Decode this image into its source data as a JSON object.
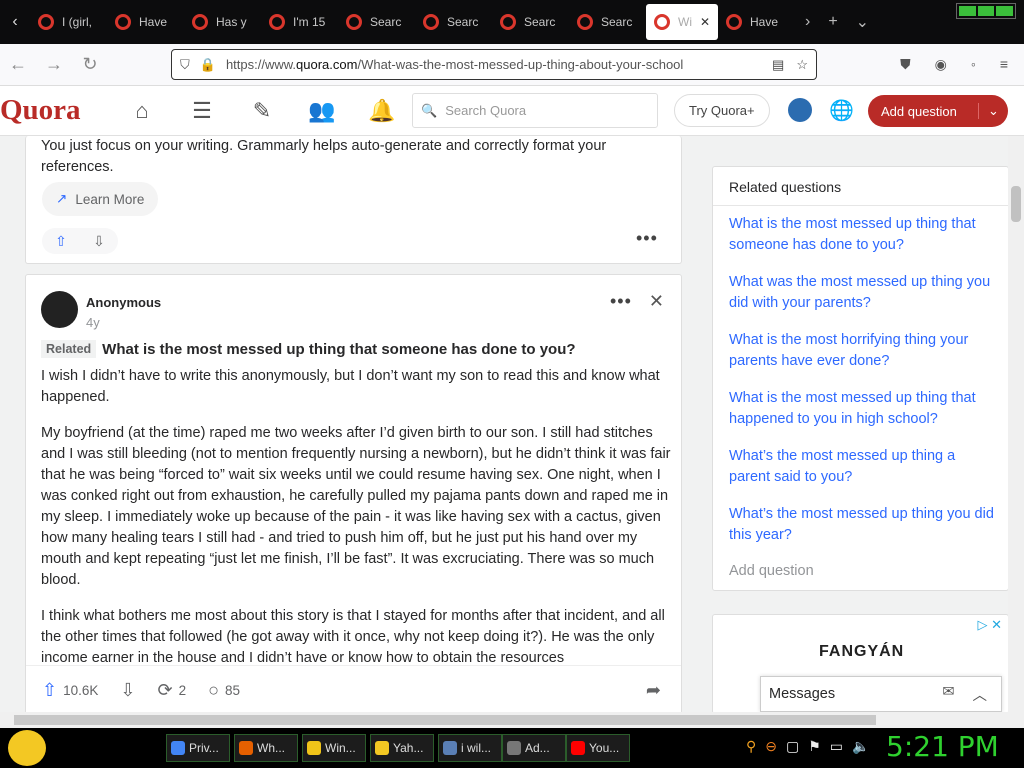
{
  "browser": {
    "tabs": [
      {
        "label": "I (girl,",
        "active": false
      },
      {
        "label": "Have",
        "active": false
      },
      {
        "label": "Has y",
        "active": false
      },
      {
        "label": "I'm 15",
        "active": false
      },
      {
        "label": "Searc",
        "active": false
      },
      {
        "label": "Searc",
        "active": false
      },
      {
        "label": "Searc",
        "active": false
      },
      {
        "label": "Searc",
        "active": false
      },
      {
        "label": "Wi",
        "active": true
      },
      {
        "label": "Have",
        "active": false
      }
    ],
    "url_prefix": "https://www.",
    "url_host": "quora.com",
    "url_path": "/What-was-the-most-messed-up-thing-about-your-school"
  },
  "quora_header": {
    "brand": "Quora",
    "search_placeholder": "Search Quora",
    "try_label": "Try Quora+",
    "add_question_label": "Add question",
    "brand_color": "#b92b27"
  },
  "ad": {
    "text": "You just focus on your writing. Grammarly helps auto-generate and correctly format your references.",
    "learn_more": "Learn More"
  },
  "post": {
    "author": "Anonymous",
    "time": "4y",
    "related_tag": "Related",
    "related_question": "What is the most messed up thing that someone has done to you?",
    "paragraphs": [
      "I wish I didn’t have to write this anonymously, but I don’t want my son to read this and know what happened.",
      "My boyfriend (at the time) raped me two weeks after I’d given birth to our son. I still had stitches and I was still bleeding (not to mention frequently nursing a newborn), but he didn’t think it was fair that he was being “forced to” wait six weeks until we could resume having sex. One night, when I was conked right out from exhaustion, he carefully pulled my pajama pants down and raped me in my sleep. I immediately woke up because of the pain - it was like having sex with a cactus, given how many healing tears I still had - and tried to push him off, but he just put his hand over my mouth and kept repeating “just let me finish, I’ll be fast”. It was excruciating. There was so much blood.",
      "I think what bothers me most about this story is that I stayed for months after that incident, and all the other times that followed (he got away with it once, why not keep doing it?). He was the only income earner in the house and I didn’t have or know how to obtain the resources"
    ],
    "upvotes": "10.6K",
    "shares": "2",
    "comments": "85"
  },
  "sidebar": {
    "title": "Related questions",
    "links": [
      "What is the most messed up thing that someone has done to you?",
      "What was the most messed up thing you did with your parents?",
      "What is the most horrifying thing your parents have ever done?",
      "What is the most messed up thing that happened to you in high school?",
      "What’s the most messed up thing a parent said to you?",
      "What’s the most messed up thing you did this year?"
    ],
    "add_question": "Add question",
    "link_color": "#2e69ff"
  },
  "ad2": {
    "brand": "FANGYÁN"
  },
  "messages": {
    "label": "Messages"
  },
  "taskbar": {
    "items": [
      {
        "label": "Priv...",
        "color": "#4285f4"
      },
      {
        "label": "Wh...",
        "color": "#e66000"
      },
      {
        "label": "Win...",
        "color": "#f0c419"
      },
      {
        "label": "Yah...",
        "color": "#f3c823"
      },
      {
        "label": "i wil...",
        "color": "#5a7fb5"
      },
      {
        "label": "Ad...",
        "color": "#777777"
      },
      {
        "label": "You...",
        "color": "#ff0000"
      }
    ],
    "clock": "5:21 PM"
  }
}
